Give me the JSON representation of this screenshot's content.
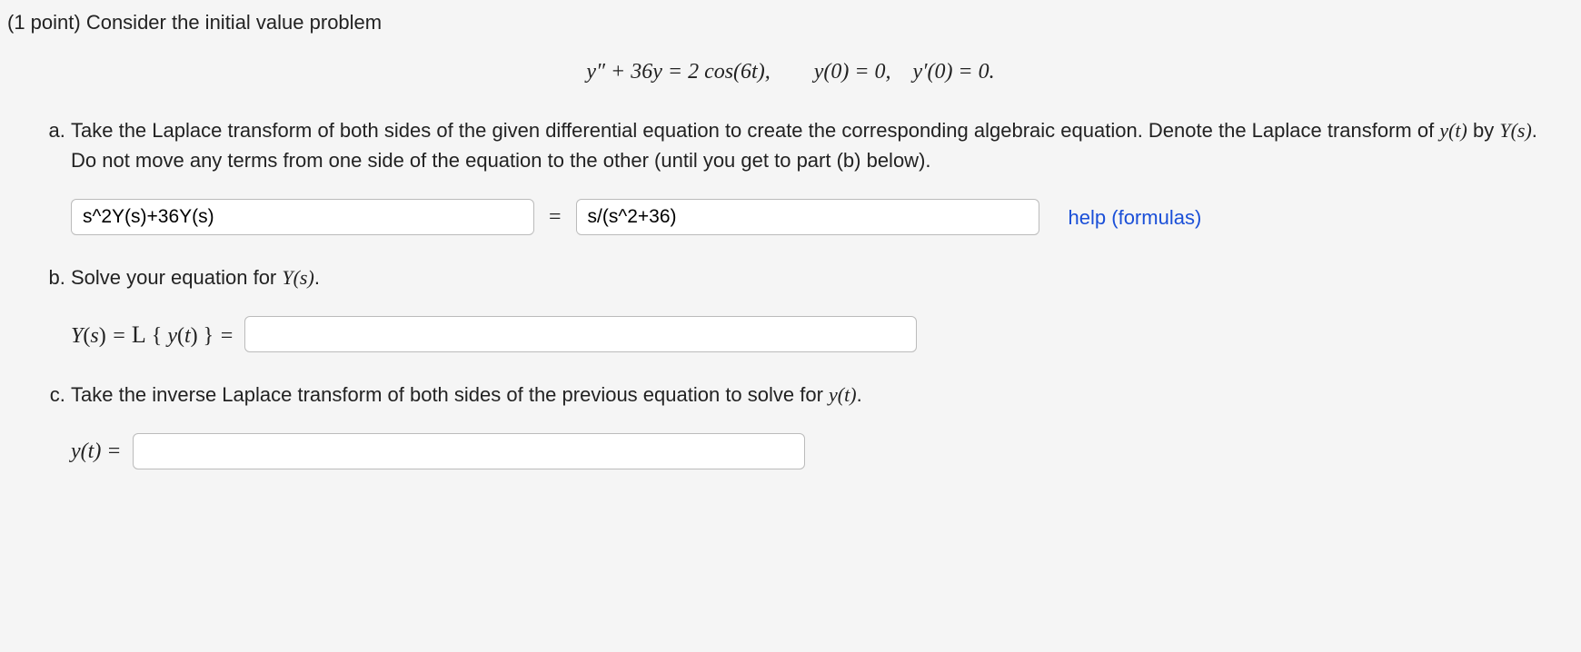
{
  "intro": {
    "points_prefix": "(1 point) ",
    "text": "Consider the initial value problem"
  },
  "equation": "y″ + 36y = 2 cos(6t),  y(0) = 0, y′(0) = 0.",
  "parts": {
    "a": {
      "text_before": "Take the Laplace transform of both sides of the given differential equation to create the corresponding algebraic equation. Denote the Laplace transform of ",
      "yt": "y(t)",
      "text_mid": " by ",
      "Ys": "Y(s)",
      "text_after": ". Do not move any terms from one side of the equation to the other (until you get to part (b) below).",
      "input_left": "s^2Y(s)+36Y(s)",
      "equals": "=",
      "input_right": "s/(s^2+36)",
      "help": "help (formulas)"
    },
    "b": {
      "text_before": "Solve your equation for ",
      "Ys": "Y(s)",
      "dot": ".",
      "label": "Y(s) = ℒ { y(t) } =",
      "input": ""
    },
    "c": {
      "text_before": "Take the inverse Laplace transform of both sides of the previous equation to solve for ",
      "yt": "y(t)",
      "dot": ".",
      "label": "y(t) =",
      "input": ""
    }
  }
}
